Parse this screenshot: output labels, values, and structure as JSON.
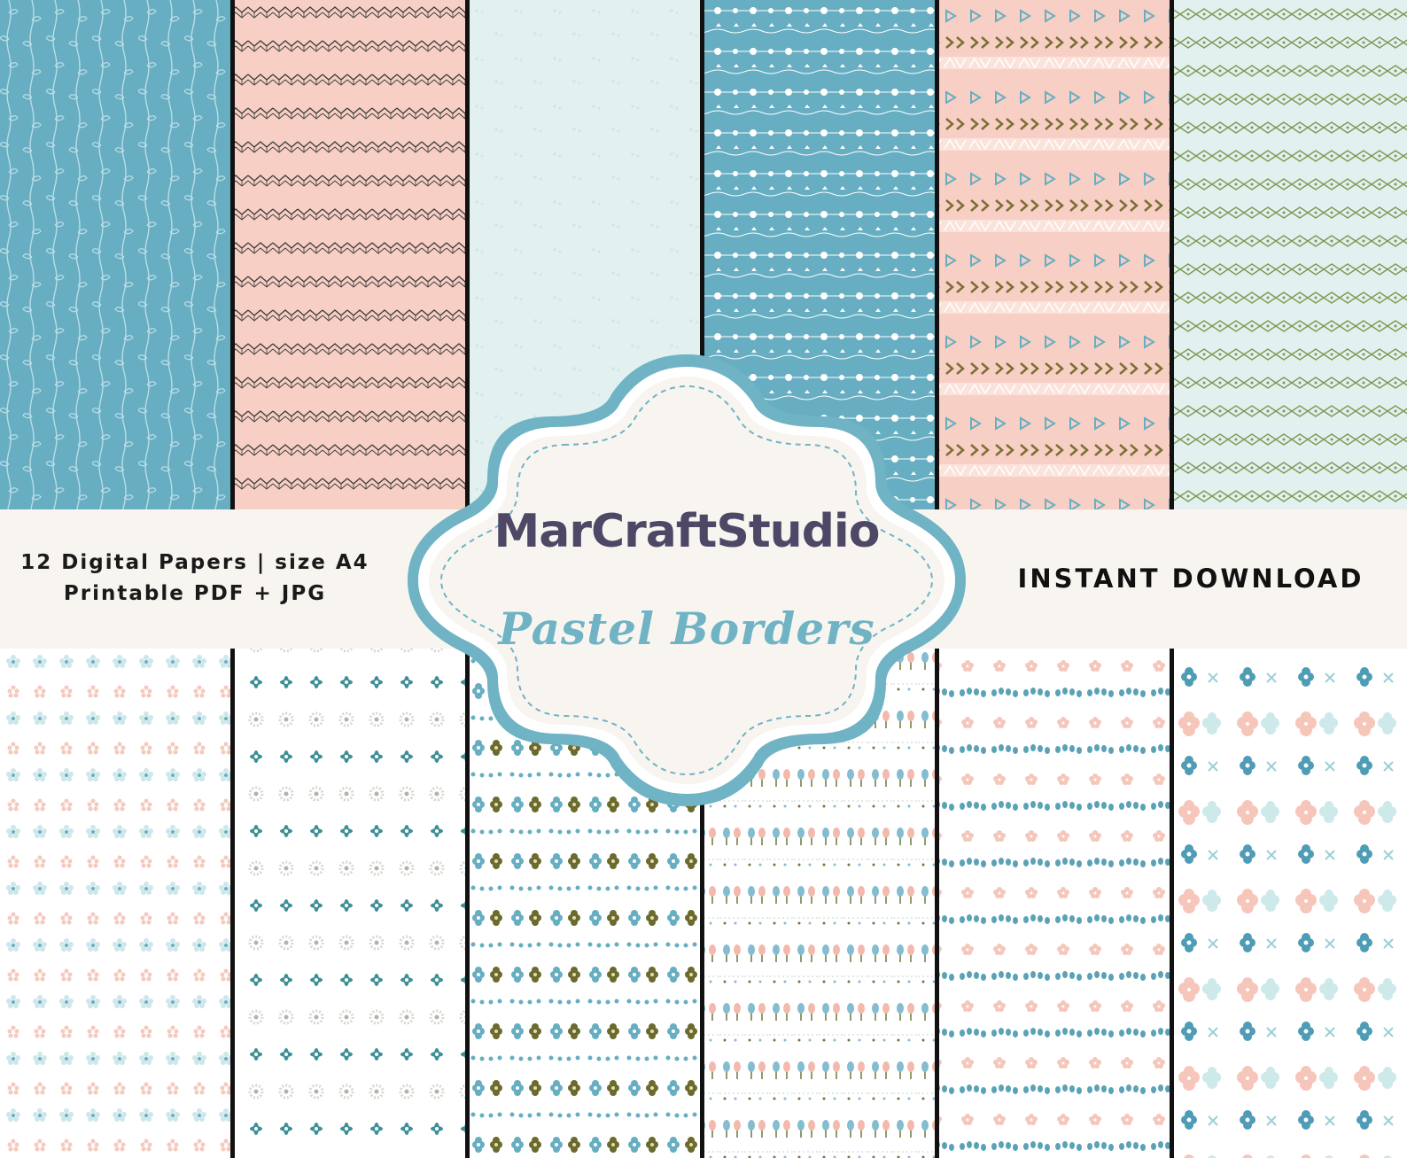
{
  "badge": {
    "brand": "MarCraftStudio",
    "title": "Pastel Borders"
  },
  "info_left": {
    "line1": "12 Digital Papers | size A4",
    "line2": "Printable PDF + JPG"
  },
  "info_right": {
    "text": "INSTANT DOWNLOAD"
  },
  "colors": {
    "teal": "#67aec2",
    "pink": "#f7cfc4",
    "mint": "#e2f1f0",
    "cream": "#f8f5f0",
    "olive": "#6b6b2e",
    "navy_text": "#4e4866",
    "badge_blue": "#6fb3c4",
    "divider": "#111111"
  },
  "papers_top": [
    {
      "name": "teal-vine-paper",
      "pattern": "vine"
    },
    {
      "name": "pink-zigzag-paper",
      "pattern": "zigzag"
    },
    {
      "name": "mint-dots-paper",
      "pattern": "faint-dots"
    },
    {
      "name": "teal-flower-string-paper",
      "pattern": "flower-string"
    },
    {
      "name": "pink-triangle-arrow-paper",
      "pattern": "triangles-chevrons"
    },
    {
      "name": "mint-diamond-chain-paper",
      "pattern": "diamond-chain"
    }
  ],
  "papers_bottom": [
    {
      "name": "daisy-rows-paper",
      "pattern": "daisy-rows"
    },
    {
      "name": "teal-star-flower-paper",
      "pattern": "star-flowers"
    },
    {
      "name": "flower-bead-paper",
      "pattern": "flower-beads"
    },
    {
      "name": "tulip-rows-paper",
      "pattern": "tulips"
    },
    {
      "name": "leaf-sprig-paper",
      "pattern": "sprigs"
    },
    {
      "name": "blossom-paper",
      "pattern": "blossoms"
    }
  ]
}
